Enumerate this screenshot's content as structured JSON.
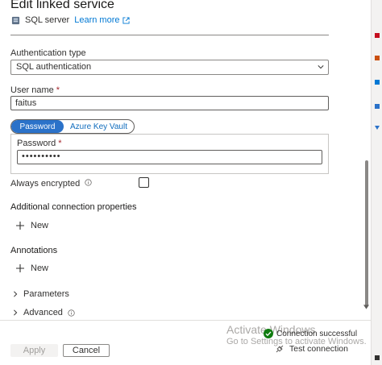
{
  "header": {
    "title": "Edit linked service",
    "service_type": "SQL server",
    "learn_more": "Learn more"
  },
  "form": {
    "auth_type": {
      "label": "Authentication type",
      "value": "SQL authentication"
    },
    "username": {
      "label": "User name",
      "required_mark": "*",
      "value": "faitus"
    },
    "password_source": {
      "options": [
        "Password",
        "Azure Key Vault"
      ],
      "selected": "Password"
    },
    "password": {
      "label": "Password",
      "required_mark": "*",
      "value": "••••••••••"
    },
    "always_encrypted": {
      "label": "Always encrypted",
      "checked": false
    },
    "additional_connection_properties": {
      "label": "Additional connection properties",
      "new_label": "New"
    },
    "annotations": {
      "label": "Annotations",
      "new_label": "New"
    },
    "parameters": {
      "label": "Parameters"
    },
    "advanced": {
      "label": "Advanced"
    }
  },
  "footer": {
    "apply_label": "Apply",
    "cancel_label": "Cancel",
    "connection_status": "Connection successful",
    "test_connection_label": "Test connection"
  },
  "watermark": {
    "line1": "Activate Windows",
    "line2": "Go to Settings to activate Windows."
  },
  "colors": {
    "accent": "#2b72c9",
    "link": "#0078d4",
    "success": "#107c10",
    "required": "#a4262c"
  }
}
